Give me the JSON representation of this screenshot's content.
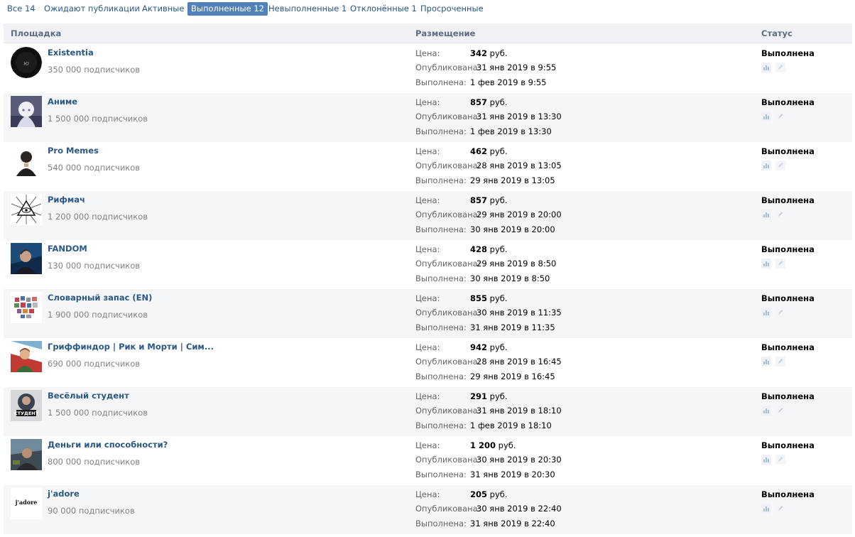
{
  "tabs": [
    {
      "label": "Все 14",
      "active": false
    },
    {
      "label": "Ожидают публикации",
      "active": false
    },
    {
      "label": "Активные",
      "active": false
    },
    {
      "label": "Выполненные 12",
      "active": true
    },
    {
      "label": "Невыполненные 1",
      "active": false
    },
    {
      "label": "Отклонённые 1",
      "active": false
    },
    {
      "label": "Просроченные",
      "active": false
    }
  ],
  "columns": {
    "platform": "Площадка",
    "placement": "Размещение",
    "status": "Статус"
  },
  "labels": {
    "price": "Цена:",
    "published": "Опубликована:",
    "done": "Выполнена:",
    "currency": "руб."
  },
  "rows": [
    {
      "name": "Existentia",
      "subscribers": "350 000 подписчиков",
      "price": "342",
      "published": "31 янв 2019 в 9:55",
      "done": "1 фев 2019 в 9:55",
      "status": "Выполнена",
      "avatar": "existentia-avatar",
      "icons": [
        "stats-icon",
        "edit-icon"
      ]
    },
    {
      "name": "Аниме",
      "subscribers": "1 500 000 подписчиков",
      "price": "857",
      "published": "31 янв 2019 в 13:30",
      "done": "1 фев 2019 в 13:30",
      "status": "Выполнена",
      "avatar": "anime-avatar",
      "icons": [
        "stats-icon",
        "edit-icon"
      ]
    },
    {
      "name": "Pro Memes",
      "subscribers": "540 000 подписчиков",
      "price": "462",
      "published": "28 янв 2019 в 13:05",
      "done": "29 янв 2019 в 13:05",
      "status": "Выполнена",
      "avatar": "pro-memes-avatar",
      "icons": [
        "stats-icon",
        "edit-icon"
      ]
    },
    {
      "name": "Рифмач",
      "subscribers": "1 200 000 подписчиков",
      "price": "857",
      "published": "29 янв 2019 в 20:00",
      "done": "30 янв 2019 в 20:00",
      "status": "Выполнена",
      "avatar": "rifmach-avatar",
      "icons": [
        "stats-icon",
        "edit-icon"
      ]
    },
    {
      "name": "FANDOM",
      "subscribers": "130 000 подписчиков",
      "price": "428",
      "published": "29 янв 2019 в 8:50",
      "done": "30 янв 2019 в 8:50",
      "status": "Выполнена",
      "avatar": "fandom-avatar",
      "icons": [
        "stats-icon",
        "edit-icon"
      ]
    },
    {
      "name": "Словарный запас (EN)",
      "subscribers": "1 900 000 подписчиков",
      "price": "855",
      "published": "30 янв 2019 в 11:35",
      "done": "31 янв 2019 в 11:35",
      "status": "Выполнена",
      "avatar": "vocabulary-avatar",
      "icons": [
        "stats-icon",
        "edit-icon"
      ]
    },
    {
      "name": "Гриффиндор | Рик и Морти | Сим...",
      "subscribers": "690 000 подписчиков",
      "price": "942",
      "published": "28 янв 2019 в 16:45",
      "done": "29 янв 2019 в 16:45",
      "status": "Выполнена",
      "avatar": "gryffindor-avatar",
      "icons": [
        "stats-icon",
        "edit-icon"
      ]
    },
    {
      "name": "Весёлый студент",
      "subscribers": "1 500 000 подписчиков",
      "price": "291",
      "published": "31 янв 2019 в 18:10",
      "done": "1 фев 2019 в 18:10",
      "status": "Выполнена",
      "avatar": "student-avatar",
      "icons": [
        "stats-icon",
        "edit-icon"
      ]
    },
    {
      "name": "Деньги или способности?",
      "subscribers": "800 000 подписчиков",
      "price": "1 200",
      "published": "30 янв 2019 в 20:30",
      "done": "31 янв 2019 в 20:30",
      "status": "Выполнена",
      "avatar": "money-avatar",
      "icons": [
        "stats-icon",
        "edit-icon"
      ]
    },
    {
      "name": "j'adore",
      "subscribers": "90 000 подписчиков",
      "price": "205",
      "published": "30 янв 2019 в 22:40",
      "done": "31 янв 2019 в 22:40",
      "status": "Выполнена",
      "avatar": "jadore-avatar",
      "avatar_text": "j'adore",
      "icons": [
        "stats-icon",
        "edit-icon"
      ]
    }
  ]
}
